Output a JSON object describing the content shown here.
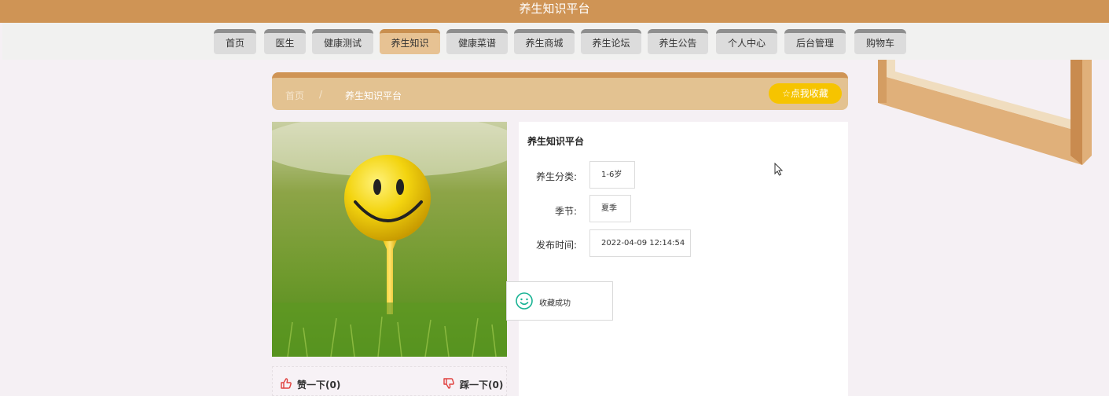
{
  "site": {
    "title": "养生知识平台"
  },
  "nav": {
    "items": [
      {
        "label": "首页"
      },
      {
        "label": "医生"
      },
      {
        "label": "健康测试"
      },
      {
        "label": "养生知识"
      },
      {
        "label": "健康菜谱"
      },
      {
        "label": "养生商城"
      },
      {
        "label": "养生论坛"
      },
      {
        "label": "养生公告"
      },
      {
        "label": "个人中心"
      },
      {
        "label": "后台管理"
      },
      {
        "label": "购物车"
      }
    ],
    "active": "养生知识"
  },
  "breadcrumb": {
    "home": "首页",
    "separator": "/",
    "current": "养生知识平台"
  },
  "favorite_button": {
    "icon": "star-outline-icon",
    "label": "☆点我收藏"
  },
  "article": {
    "title": "养生知识平台",
    "fields": [
      {
        "label": "养生分类:",
        "value": "1-6岁"
      },
      {
        "label": "季节:",
        "value": "夏季"
      },
      {
        "label": "发布时间:",
        "value": "2022-04-09 12:14:54"
      }
    ]
  },
  "votes": {
    "like": {
      "icon": "thumbs-up-icon",
      "label": "赞一下(0)"
    },
    "dislike": {
      "icon": "thumbs-down-icon",
      "label": "踩一下(0)"
    }
  },
  "toast": {
    "icon": "smile-icon",
    "message": "收藏成功"
  },
  "colors": {
    "header": "#cf9455",
    "breadcrumb_bg": "#e3c291",
    "favorite_button": "#f6c400",
    "active_nav": "#e7c293",
    "like_icon": "#e0413f",
    "toast_icon": "#1ab394"
  }
}
